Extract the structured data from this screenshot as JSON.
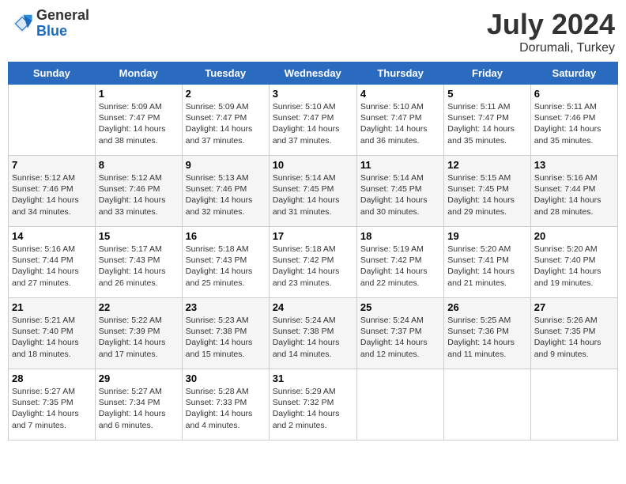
{
  "header": {
    "logo_general": "General",
    "logo_blue": "Blue",
    "month": "July 2024",
    "location": "Dorumali, Turkey"
  },
  "days_of_week": [
    "Sunday",
    "Monday",
    "Tuesday",
    "Wednesday",
    "Thursday",
    "Friday",
    "Saturday"
  ],
  "weeks": [
    [
      {
        "day": "",
        "info": ""
      },
      {
        "day": "1",
        "info": "Sunrise: 5:09 AM\nSunset: 7:47 PM\nDaylight: 14 hours\nand 38 minutes."
      },
      {
        "day": "2",
        "info": "Sunrise: 5:09 AM\nSunset: 7:47 PM\nDaylight: 14 hours\nand 37 minutes."
      },
      {
        "day": "3",
        "info": "Sunrise: 5:10 AM\nSunset: 7:47 PM\nDaylight: 14 hours\nand 37 minutes."
      },
      {
        "day": "4",
        "info": "Sunrise: 5:10 AM\nSunset: 7:47 PM\nDaylight: 14 hours\nand 36 minutes."
      },
      {
        "day": "5",
        "info": "Sunrise: 5:11 AM\nSunset: 7:47 PM\nDaylight: 14 hours\nand 35 minutes."
      },
      {
        "day": "6",
        "info": "Sunrise: 5:11 AM\nSunset: 7:46 PM\nDaylight: 14 hours\nand 35 minutes."
      }
    ],
    [
      {
        "day": "7",
        "info": "Sunrise: 5:12 AM\nSunset: 7:46 PM\nDaylight: 14 hours\nand 34 minutes."
      },
      {
        "day": "8",
        "info": "Sunrise: 5:12 AM\nSunset: 7:46 PM\nDaylight: 14 hours\nand 33 minutes."
      },
      {
        "day": "9",
        "info": "Sunrise: 5:13 AM\nSunset: 7:46 PM\nDaylight: 14 hours\nand 32 minutes."
      },
      {
        "day": "10",
        "info": "Sunrise: 5:14 AM\nSunset: 7:45 PM\nDaylight: 14 hours\nand 31 minutes."
      },
      {
        "day": "11",
        "info": "Sunrise: 5:14 AM\nSunset: 7:45 PM\nDaylight: 14 hours\nand 30 minutes."
      },
      {
        "day": "12",
        "info": "Sunrise: 5:15 AM\nSunset: 7:45 PM\nDaylight: 14 hours\nand 29 minutes."
      },
      {
        "day": "13",
        "info": "Sunrise: 5:16 AM\nSunset: 7:44 PM\nDaylight: 14 hours\nand 28 minutes."
      }
    ],
    [
      {
        "day": "14",
        "info": "Sunrise: 5:16 AM\nSunset: 7:44 PM\nDaylight: 14 hours\nand 27 minutes."
      },
      {
        "day": "15",
        "info": "Sunrise: 5:17 AM\nSunset: 7:43 PM\nDaylight: 14 hours\nand 26 minutes."
      },
      {
        "day": "16",
        "info": "Sunrise: 5:18 AM\nSunset: 7:43 PM\nDaylight: 14 hours\nand 25 minutes."
      },
      {
        "day": "17",
        "info": "Sunrise: 5:18 AM\nSunset: 7:42 PM\nDaylight: 14 hours\nand 23 minutes."
      },
      {
        "day": "18",
        "info": "Sunrise: 5:19 AM\nSunset: 7:42 PM\nDaylight: 14 hours\nand 22 minutes."
      },
      {
        "day": "19",
        "info": "Sunrise: 5:20 AM\nSunset: 7:41 PM\nDaylight: 14 hours\nand 21 minutes."
      },
      {
        "day": "20",
        "info": "Sunrise: 5:20 AM\nSunset: 7:40 PM\nDaylight: 14 hours\nand 19 minutes."
      }
    ],
    [
      {
        "day": "21",
        "info": "Sunrise: 5:21 AM\nSunset: 7:40 PM\nDaylight: 14 hours\nand 18 minutes."
      },
      {
        "day": "22",
        "info": "Sunrise: 5:22 AM\nSunset: 7:39 PM\nDaylight: 14 hours\nand 17 minutes."
      },
      {
        "day": "23",
        "info": "Sunrise: 5:23 AM\nSunset: 7:38 PM\nDaylight: 14 hours\nand 15 minutes."
      },
      {
        "day": "24",
        "info": "Sunrise: 5:24 AM\nSunset: 7:38 PM\nDaylight: 14 hours\nand 14 minutes."
      },
      {
        "day": "25",
        "info": "Sunrise: 5:24 AM\nSunset: 7:37 PM\nDaylight: 14 hours\nand 12 minutes."
      },
      {
        "day": "26",
        "info": "Sunrise: 5:25 AM\nSunset: 7:36 PM\nDaylight: 14 hours\nand 11 minutes."
      },
      {
        "day": "27",
        "info": "Sunrise: 5:26 AM\nSunset: 7:35 PM\nDaylight: 14 hours\nand 9 minutes."
      }
    ],
    [
      {
        "day": "28",
        "info": "Sunrise: 5:27 AM\nSunset: 7:35 PM\nDaylight: 14 hours\nand 7 minutes."
      },
      {
        "day": "29",
        "info": "Sunrise: 5:27 AM\nSunset: 7:34 PM\nDaylight: 14 hours\nand 6 minutes."
      },
      {
        "day": "30",
        "info": "Sunrise: 5:28 AM\nSunset: 7:33 PM\nDaylight: 14 hours\nand 4 minutes."
      },
      {
        "day": "31",
        "info": "Sunrise: 5:29 AM\nSunset: 7:32 PM\nDaylight: 14 hours\nand 2 minutes."
      },
      {
        "day": "",
        "info": ""
      },
      {
        "day": "",
        "info": ""
      },
      {
        "day": "",
        "info": ""
      }
    ]
  ]
}
